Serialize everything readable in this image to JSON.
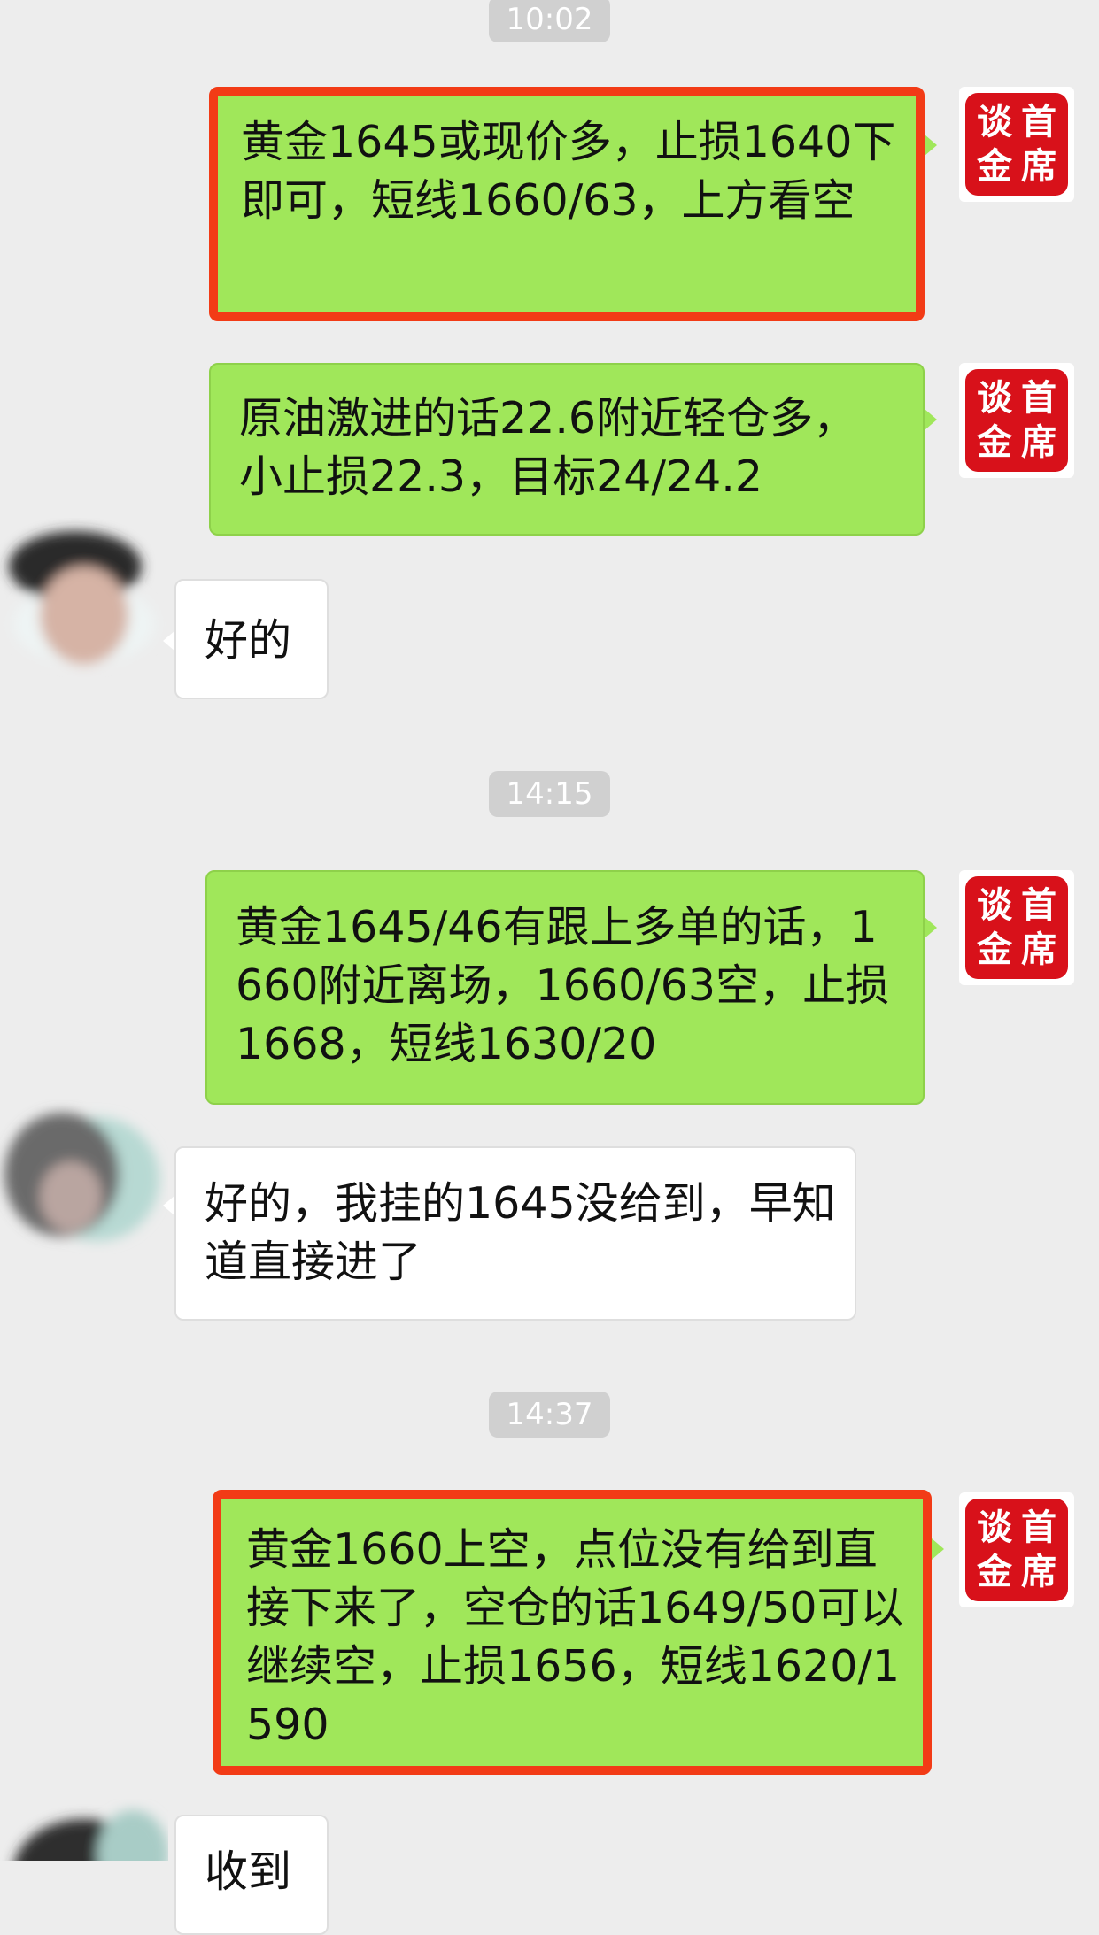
{
  "timestamps": [
    "10:02",
    "14:15",
    "14:37"
  ],
  "seal_avatar": {
    "chars": [
      "谈",
      "首",
      "金",
      "席"
    ]
  },
  "messages": [
    {
      "sender": "self",
      "text": "黄金1645或现价多，止损1640下即可，短线1660/63，上方看空",
      "highlighted": true
    },
    {
      "sender": "self",
      "text": "原油激进的话22.6附近轻仓多，小止损22.3，目标24/24.2",
      "highlighted": false
    },
    {
      "sender": "other",
      "text": "好的"
    },
    {
      "sender": "self",
      "text": "黄金1645/46有跟上多单的话，1660附近离场，1660/63空，止损1668，短线1630/20",
      "highlighted": false
    },
    {
      "sender": "other",
      "text": "好的，我挂的1645没给到，早知道直接进了"
    },
    {
      "sender": "self",
      "text": "黄金1660上空，点位没有给到直接下来了，空仓的话1649/50可以继续空，止损1656，短线1620/1590",
      "highlighted": true
    },
    {
      "sender": "other",
      "text": "收到"
    }
  ],
  "colors": {
    "background": "#ededed",
    "self_bubble": "#a0e75a",
    "other_bubble": "#ffffff",
    "highlight_border": "#f23b16",
    "seal_red": "#d8111a"
  }
}
